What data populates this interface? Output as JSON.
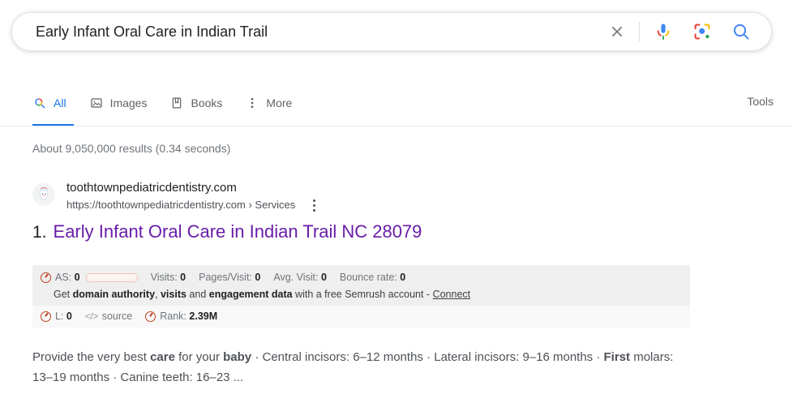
{
  "search": {
    "query": "Early Infant Oral Care in Indian Trail",
    "placeholder": "Search",
    "clear_label": "Clear",
    "voice_label": "Search by voice",
    "lens_label": "Search by image",
    "submit_label": "Google Search"
  },
  "nav": {
    "tabs": [
      {
        "label": "All",
        "icon": "search-icon",
        "active": true
      },
      {
        "label": "Images",
        "icon": "image-icon",
        "active": false
      },
      {
        "label": "Books",
        "icon": "book-icon",
        "active": false
      },
      {
        "label": "More",
        "icon": "kebab-icon",
        "active": false
      }
    ],
    "tools_label": "Tools"
  },
  "result_stats": "About 9,050,000 results (0.34 seconds)",
  "result": {
    "index": "1.",
    "site_name": "toothtownpediatricdentistry.com",
    "url": "https://toothtownpediatricdentistry.com › Services",
    "title": "Early Infant Oral Care in Indian Trail NC 28079",
    "favicon_name": "tooth-mascot-favicon",
    "snippet_parts": [
      {
        "text": "Provide the very best ",
        "bold": false
      },
      {
        "text": "care",
        "bold": true
      },
      {
        "text": " for your ",
        "bold": false
      },
      {
        "text": "baby",
        "bold": true
      },
      {
        "text": " · Central incisors: 6–12 months · Lateral incisors: 9–16 months · ",
        "bold": false
      },
      {
        "text": "First",
        "bold": true
      },
      {
        "text": " molars: 13–19 months · Canine teeth: 16–23 ...",
        "bold": false
      }
    ]
  },
  "seo_panel": {
    "metrics": [
      {
        "label": "AS:",
        "value": "0",
        "has_bar": true,
        "has_ring": true
      },
      {
        "label": "Visits:",
        "value": "0",
        "has_bar": false,
        "has_ring": false
      },
      {
        "label": "Pages/Visit:",
        "value": "0",
        "has_bar": false,
        "has_ring": false
      },
      {
        "label": "Avg. Visit:",
        "value": "0",
        "has_bar": false,
        "has_ring": false
      },
      {
        "label": "Bounce rate:",
        "value": "0",
        "has_bar": false,
        "has_ring": false
      }
    ],
    "promo_parts": [
      {
        "text": "Get ",
        "bold": false
      },
      {
        "text": "domain authority",
        "bold": true
      },
      {
        "text": ", ",
        "bold": false
      },
      {
        "text": "visits",
        "bold": true
      },
      {
        "text": " and ",
        "bold": false
      },
      {
        "text": "engagement data",
        "bold": true
      },
      {
        "text": " with a free Semrush account - ",
        "bold": false
      }
    ],
    "promo_link": "Connect",
    "bottom": [
      {
        "label": "L:",
        "value": "0",
        "icon": "semrush-ring-icon"
      },
      {
        "label": "source",
        "value": "",
        "icon": "code-icon"
      },
      {
        "label": "Rank:",
        "value": "2.39M",
        "icon": "semrush-ring-icon"
      }
    ]
  },
  "colors": {
    "google_blue": "#1a73e8",
    "visited_purple": "#681da8",
    "semrush_orange": "#bf3d1e",
    "text_gray": "#5f6368"
  }
}
